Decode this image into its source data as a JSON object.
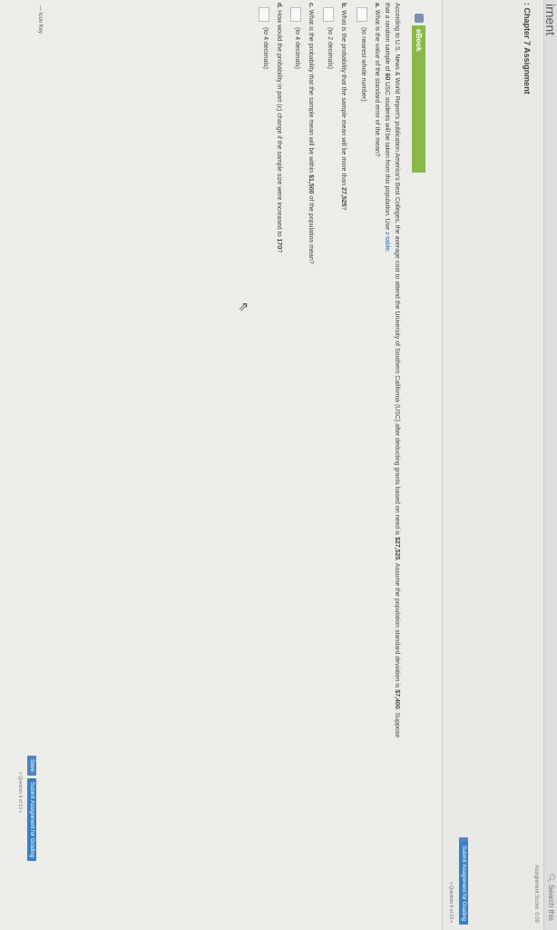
{
  "window": {
    "title": "irnent",
    "search_label": "Search this"
  },
  "assignment": {
    "title": ": Chapter 7 Assignment",
    "score_label": "Assignment Score: 0.00",
    "save_label": "Save",
    "submit_label": "Submit Assignment for Grading",
    "question_nav": "« Question 6 of 13 »"
  },
  "ebook": {
    "label": "eBook"
  },
  "problem": {
    "line1_pre": "According to U.S. News & World Report's publication America's Best Colleges, the average cost to attend the University of Southern California (USC) after deducting grants based on need is ",
    "mean": "$27,525",
    "line1_mid": ". Assume the population standard deviation is ",
    "stdev": "$7,400",
    "line1_post": ". Suppose",
    "line2_pre": "that a random sample of ",
    "sample_size": "60",
    "line2_mid": " USC students will be taken from this population. Use ",
    "ztable_link": "z-table",
    "line2_post": ".",
    "a_label": "a.",
    "a_text": " What is the value of the standard error of the mean?",
    "a_hint": "(to nearest whole number)",
    "b_label": "b.",
    "b_text_pre": " What is the probability that the sample mean will be more than ",
    "b_value": "27,525",
    "b_text_post": "?",
    "b_hint": "(to 2 decimals)",
    "c_label": "c.",
    "c_text_pre": " What is the probability that the sample mean will be within ",
    "c_value": "$1,500",
    "c_text_post": " of the population mean?",
    "c_hint": "(to 4 decimals)",
    "d_label": "d.",
    "d_text_pre": " How would the probability in part (c) change if the sample size were increased to ",
    "d_value": "170",
    "d_text_post": "?",
    "d_hint": "(to 4 decimals)"
  },
  "footer": {
    "icon_key": "Icon Key",
    "save_label": "Save",
    "submit_label": "Submit Assignment for Grading",
    "question_nav": "« Question 6 of 13 »"
  },
  "taskbar": {
    "time": "6:50 PM"
  }
}
